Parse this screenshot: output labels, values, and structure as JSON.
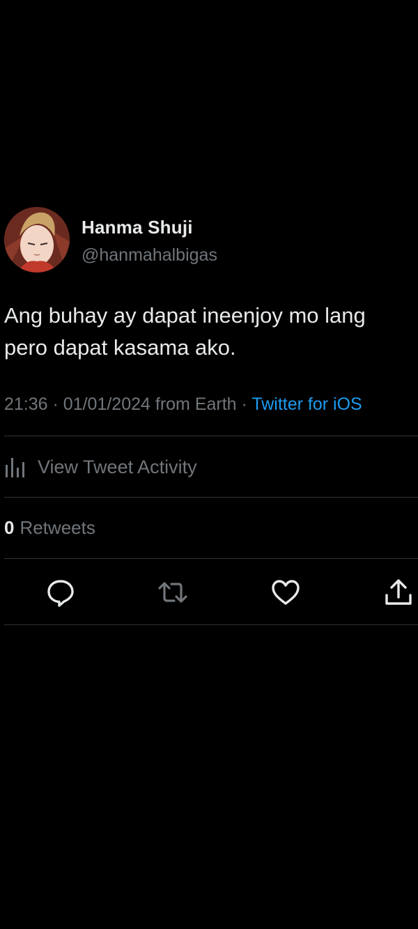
{
  "tweet": {
    "author": {
      "display_name": "Hanma Shuji",
      "handle": "@hanmahalbigas"
    },
    "text_lines": [
      "Ang buhay ay dapat ineenjoy mo lang",
      "pero dapat kasama ako."
    ],
    "time": "21:36",
    "date": "01/01/2024",
    "location": "from Earth",
    "separator": "·",
    "source": "Twitter for iOS",
    "activity_label": "View Tweet Activity",
    "retweets": {
      "count": "0",
      "label": "Retweets"
    }
  },
  "actions": [
    {
      "name": "reply",
      "icon": "reply-icon"
    },
    {
      "name": "retweet",
      "icon": "retweet-icon"
    },
    {
      "name": "like",
      "icon": "heart-icon"
    },
    {
      "name": "share",
      "icon": "share-icon"
    }
  ],
  "colors": {
    "background": "#000000",
    "text": "#e7e9ea",
    "muted": "#71767b",
    "link": "#1d9bf0",
    "divider": "#2f3336"
  }
}
